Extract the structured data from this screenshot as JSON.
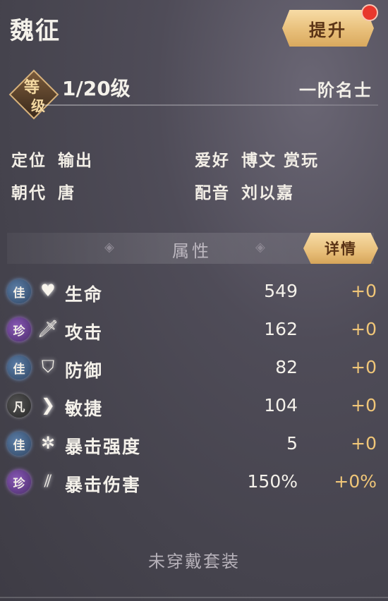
{
  "header": {
    "name": "魏征",
    "upgrade_label": "提升"
  },
  "level": {
    "badge_top": "等",
    "badge_bottom": "级",
    "value": "1/20级",
    "rank": "一阶名士"
  },
  "info": {
    "position_label": "定位",
    "position_value": "输出",
    "hobby_label": "爱好",
    "hobby_value": "博文 赏玩",
    "dynasty_label": "朝代",
    "dynasty_value": "唐",
    "voice_label": "配音",
    "voice_value": "刘以嘉"
  },
  "attributes": {
    "title": "属性",
    "detail_label": "详情",
    "rows": [
      {
        "grade": "佳",
        "grade_type": "jia",
        "icon": "heart-icon",
        "name": "生命",
        "value": "549",
        "bonus": "+0"
      },
      {
        "grade": "珍",
        "grade_type": "zhen",
        "icon": "sword-icon",
        "name": "攻击",
        "value": "162",
        "bonus": "+0"
      },
      {
        "grade": "佳",
        "grade_type": "jia",
        "icon": "shield-icon",
        "name": "防御",
        "value": "82",
        "bonus": "+0"
      },
      {
        "grade": "凡",
        "grade_type": "fan",
        "icon": "boot-icon",
        "name": "敏捷",
        "value": "104",
        "bonus": "+0"
      },
      {
        "grade": "佳",
        "grade_type": "jia",
        "icon": "star-burst-icon",
        "name": "暴击强度",
        "value": "5",
        "bonus": "+0"
      },
      {
        "grade": "珍",
        "grade_type": "zhen",
        "icon": "slash-icon",
        "name": "暴击伤害",
        "value": "150%",
        "bonus": "+0%"
      }
    ]
  },
  "set": {
    "text": "未穿戴套装"
  },
  "colors": {
    "accent_gold": "#f0c678",
    "button_gold": "#e8bf7a",
    "notify_red": "#e8372c"
  }
}
